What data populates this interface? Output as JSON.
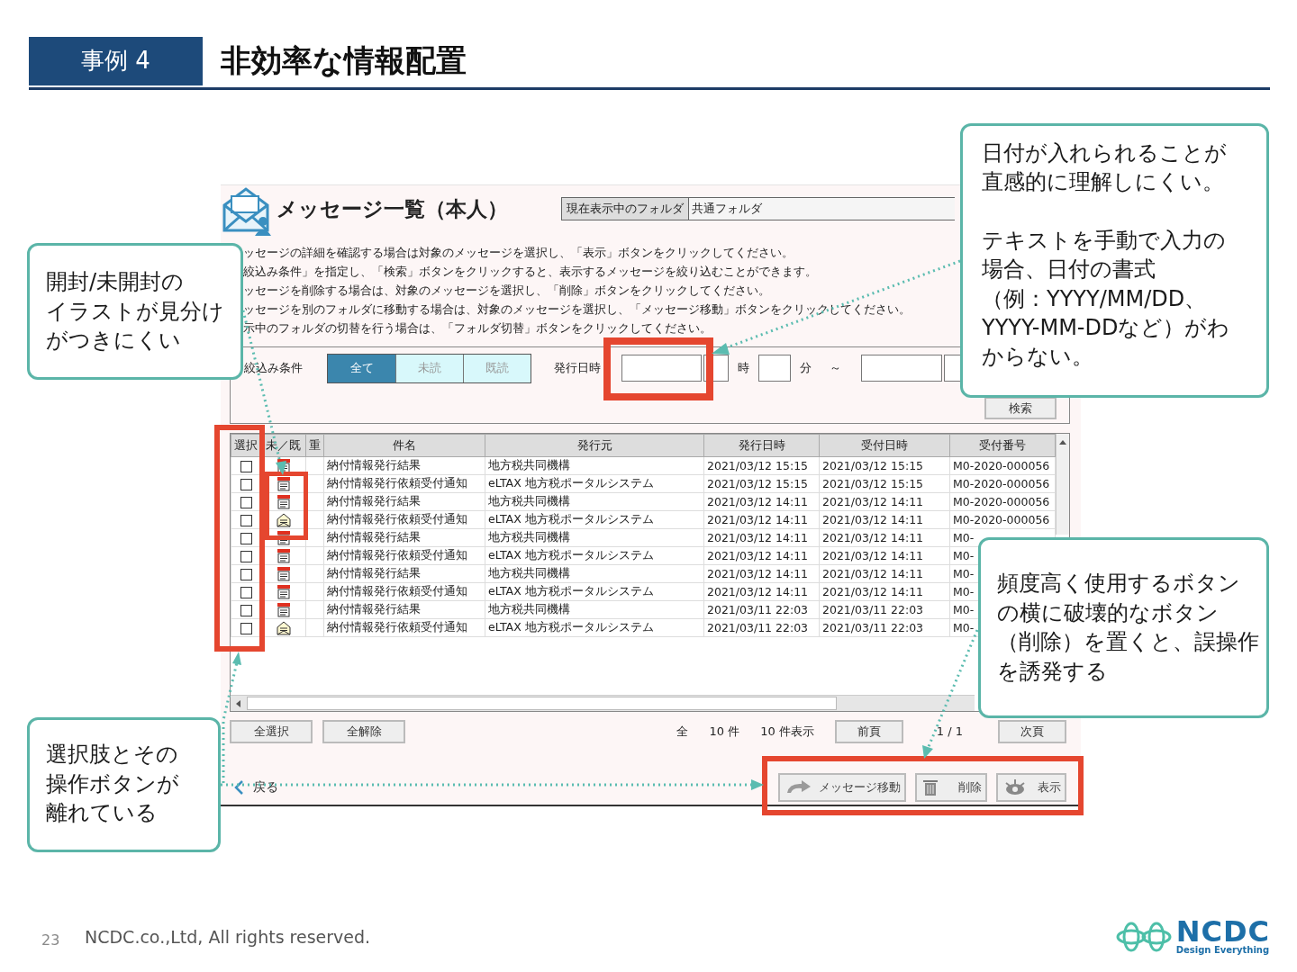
{
  "slide": {
    "badge": "事例 4",
    "title": "非効率な情報配置",
    "page_number": "23",
    "copyright": "NCDC.co.,Ltd, All rights reserved.",
    "logo": {
      "name": "NCDC",
      "tagline": "Design Everything"
    }
  },
  "app": {
    "title": "メッセージ一覧（本人）",
    "folder_label": "現在表示中のフォルダ",
    "folder_value": "共通フォルダ",
    "instructions": [
      "ッセージの詳細を確認する場合は対象のメッセージを選択し、「表示」ボタンをクリックしてください。",
      "絞込み条件」を指定し、「検索」ボタンをクリックすると、表示するメッセージを絞り込むことができます。",
      "ッセージを削除する場合は、対象のメッセージを選択し、「削除」ボタンをクリックしてください。",
      "ッセージを別のフォルダに移動する場合は、対象のメッセージを選択し、「メッセージ移動」ボタンをクリックしてください。",
      "示中のフォルダの切替を行う場合は、「フォルダ切替」ボタンをクリックしてください。"
    ],
    "filter": {
      "label": "絞込み条件",
      "options": [
        {
          "label": "全て",
          "selected": true
        },
        {
          "label": "未読",
          "selected": false
        },
        {
          "label": "既読",
          "selected": false
        }
      ],
      "date_label": "発行日時",
      "hour_label": "時",
      "minute_label": "分",
      "range_mark": "～",
      "search_button": "検索"
    },
    "table": {
      "columns": [
        "選択",
        "未／既",
        "重",
        "件名",
        "発行元",
        "発行日時",
        "受付日時",
        "受付番号"
      ],
      "rows": [
        {
          "checked": false,
          "unread": true,
          "subject": "納付情報発行結果",
          "sender": "地方税共同機構",
          "issued": "2021/03/12 15:15",
          "received": "2021/03/12 15:15",
          "number": "M0-2020-000056"
        },
        {
          "checked": false,
          "unread": true,
          "subject": "納付情報発行依頼受付通知",
          "sender": "eLTAX 地方税ポータルシステム",
          "issued": "2021/03/12 15:15",
          "received": "2021/03/12 15:15",
          "number": "M0-2020-000056"
        },
        {
          "checked": false,
          "unread": true,
          "subject": "納付情報発行結果",
          "sender": "地方税共同機構",
          "issued": "2021/03/12 14:11",
          "received": "2021/03/12 14:11",
          "number": "M0-2020-000056"
        },
        {
          "checked": false,
          "unread": false,
          "subject": "納付情報発行依頼受付通知",
          "sender": "eLTAX 地方税ポータルシステム",
          "issued": "2021/03/12 14:11",
          "received": "2021/03/12 14:11",
          "number": "M0-2020-000056"
        },
        {
          "checked": false,
          "unread": true,
          "subject": "納付情報発行結果",
          "sender": "地方税共同機構",
          "issued": "2021/03/12 14:11",
          "received": "2021/03/12 14:11",
          "number": "M0-"
        },
        {
          "checked": false,
          "unread": true,
          "subject": "納付情報発行依頼受付通知",
          "sender": "eLTAX 地方税ポータルシステム",
          "issued": "2021/03/12 14:11",
          "received": "2021/03/12 14:11",
          "number": "M0-"
        },
        {
          "checked": false,
          "unread": true,
          "subject": "納付情報発行結果",
          "sender": "地方税共同機構",
          "issued": "2021/03/12 14:11",
          "received": "2021/03/12 14:11",
          "number": "M0-"
        },
        {
          "checked": false,
          "unread": true,
          "subject": "納付情報発行依頼受付通知",
          "sender": "eLTAX 地方税ポータルシステム",
          "issued": "2021/03/12 14:11",
          "received": "2021/03/12 14:11",
          "number": "M0-"
        },
        {
          "checked": false,
          "unread": true,
          "subject": "納付情報発行結果",
          "sender": "地方税共同機構",
          "issued": "2021/03/11 22:03",
          "received": "2021/03/11 22:03",
          "number": "M0-"
        },
        {
          "checked": false,
          "unread": false,
          "subject": "納付情報発行依頼受付通知",
          "sender": "eLTAX 地方税ポータルシステム",
          "issued": "2021/03/11 22:03",
          "received": "2021/03/11 22:03",
          "number": "M0-"
        }
      ]
    },
    "footer": {
      "select_all": "全選択",
      "clear_all": "全解除",
      "total_prefix": "全",
      "total_count": "10 件",
      "per_page": "10 件表示",
      "prev": "前頁",
      "page": "1 / 1",
      "next": "次頁"
    },
    "actions": {
      "back": "戻る",
      "buttons": [
        {
          "kind": "move",
          "label": "メッセージ移動"
        },
        {
          "kind": "delete",
          "label": "削除"
        },
        {
          "kind": "view",
          "label": "表示"
        }
      ]
    }
  },
  "callouts": [
    {
      "paragraphs": [
        [
          "開封/未開封の",
          "イラストが見分け",
          "がつきにくい"
        ]
      ]
    },
    {
      "paragraphs": [
        [
          "日付が入れられることが",
          "直感的に理解しにくい。"
        ],
        [
          "テキストを手動で入力の",
          "場合、日付の書式",
          "（例：YYYY/MM/DD、",
          "YYYY-MM-DDなど）がわ",
          "からない。"
        ]
      ]
    },
    {
      "paragraphs": [
        [
          "頻度高く使用するボタン",
          "の横に破壊的なボタン",
          "（削除）を置くと、誤操作",
          "を誘発する"
        ]
      ]
    },
    {
      "paragraphs": [
        [
          "選択肢とその",
          "操作ボタンが",
          "離れている"
        ]
      ]
    }
  ]
}
